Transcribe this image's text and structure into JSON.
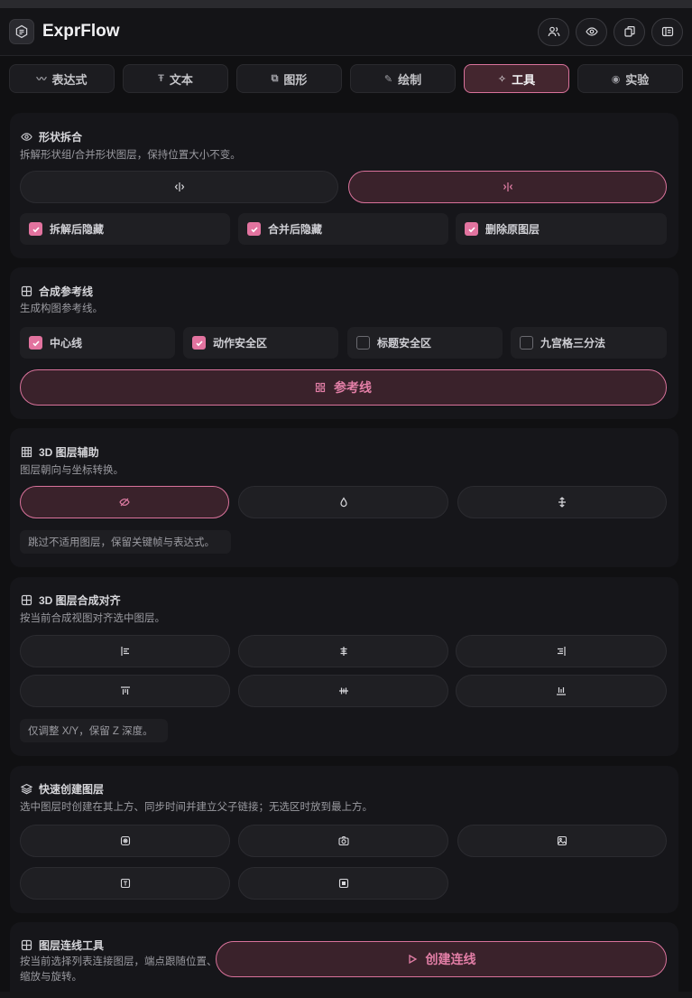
{
  "app": {
    "title": "ExprFlow"
  },
  "header_buttons": [
    "users-icon",
    "eye-icon",
    "copy-icon",
    "panel-icon"
  ],
  "tabs": [
    {
      "label": "表达式",
      "icon": "wave-icon"
    },
    {
      "label": "文本",
      "icon": "text-icon"
    },
    {
      "label": "图形",
      "icon": "shape-icon"
    },
    {
      "label": "绘制",
      "icon": "draw-icon"
    },
    {
      "label": "工具",
      "icon": "sparkle-icon",
      "active": true
    },
    {
      "label": "实验",
      "icon": "eye-icon"
    }
  ],
  "shape_split": {
    "title": "形状拆合",
    "desc": "拆解形状组/合并形状图层，保持位置大小不变。",
    "options": [
      {
        "label": "拆解后隐藏",
        "checked": true
      },
      {
        "label": "合并后隐藏",
        "checked": true
      },
      {
        "label": "删除原图层",
        "checked": true
      }
    ]
  },
  "guides": {
    "title": "合成参考线",
    "desc": "生成构图参考线。",
    "options": [
      {
        "label": "中心线",
        "checked": true
      },
      {
        "label": "动作安全区",
        "checked": true
      },
      {
        "label": "标题安全区",
        "checked": false
      },
      {
        "label": "九宫格三分法",
        "checked": false
      }
    ],
    "button_label": "参考线"
  },
  "layer3d": {
    "title": "3D 图层辅助",
    "desc": "图层朝向与坐标转换。",
    "note": "跳过不适用图层，保留关键帧与表达式。"
  },
  "align3d": {
    "title": "3D 图层合成对齐",
    "desc": "按当前合成视图对齐选中图层。",
    "note": "仅调整 X/Y，保留 Z 深度。"
  },
  "quick_create": {
    "title": "快速创建图层",
    "desc": "选中图层时创建在其上方、同步时间并建立父子链接；无选区时放到最上方。"
  },
  "connect": {
    "title": "图层连线工具",
    "desc": "按当前选择列表连接图层，端点跟随位置、缩放与旋转。",
    "button_label": "创建连线"
  },
  "colors": {
    "accent": "#e2739f",
    "accent_bg": "#3a222b",
    "panel": "#16161a",
    "background": "#101012"
  }
}
